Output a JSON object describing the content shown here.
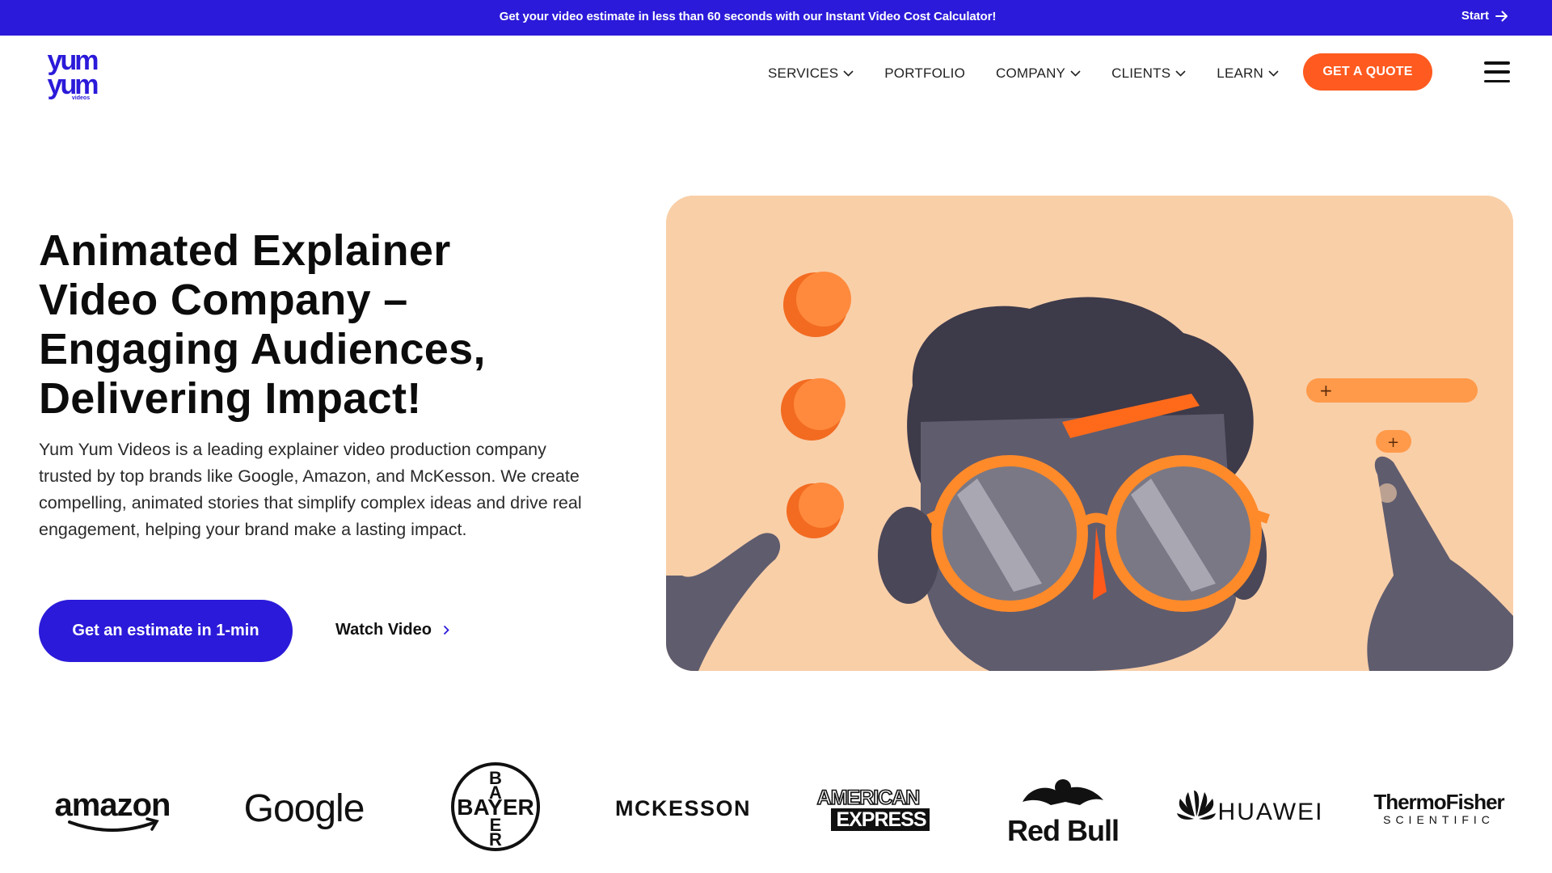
{
  "topbar": {
    "message": "Get your video estimate in less than 60 seconds with our Instant Video Cost Calculator!",
    "start_label": "Start"
  },
  "header": {
    "logo_alt": "yum yum videos",
    "logo_top": "yum",
    "logo_bottom": "yum",
    "logo_sub": "videos",
    "nav": [
      {
        "label": "SERVICES",
        "dropdown": true
      },
      {
        "label": "PORTFOLIO",
        "dropdown": false
      },
      {
        "label": "COMPANY",
        "dropdown": true
      },
      {
        "label": "CLIENTS",
        "dropdown": true
      },
      {
        "label": "LEARN",
        "dropdown": true
      }
    ],
    "quote_label": "GET A QUOTE"
  },
  "hero": {
    "title_line1": "Animated Explainer",
    "title_line2": "Video Company –",
    "title_line3": "Engaging Audiences,",
    "title_line4": "Delivering Impact!",
    "description": "Yum Yum Videos is a leading explainer video production company trusted by top brands like Google, Amazon, and McKesson. We create compelling, animated stories that simplify complex ideas and drive real engagement, helping your brand make a lasting impact.",
    "cta_label": "Get an estimate in 1-min",
    "watch_label": "Watch Video"
  },
  "clients": {
    "amazon": "amazon",
    "google": "Google",
    "bayer": "BAYER",
    "mckesson": "MCKESSON",
    "amex_line1": "AMERICAN",
    "amex_line2": "EXPRESS",
    "redbull": "Red Bull",
    "huawei": "HUAWEI",
    "thermo_line1": "ThermoFisher",
    "thermo_line2": "SCIENTIFIC"
  },
  "colors": {
    "brand_blue": "#2b1ad9",
    "accent_orange": "#ff5a1f",
    "hero_bg": "#f9cfa8"
  }
}
